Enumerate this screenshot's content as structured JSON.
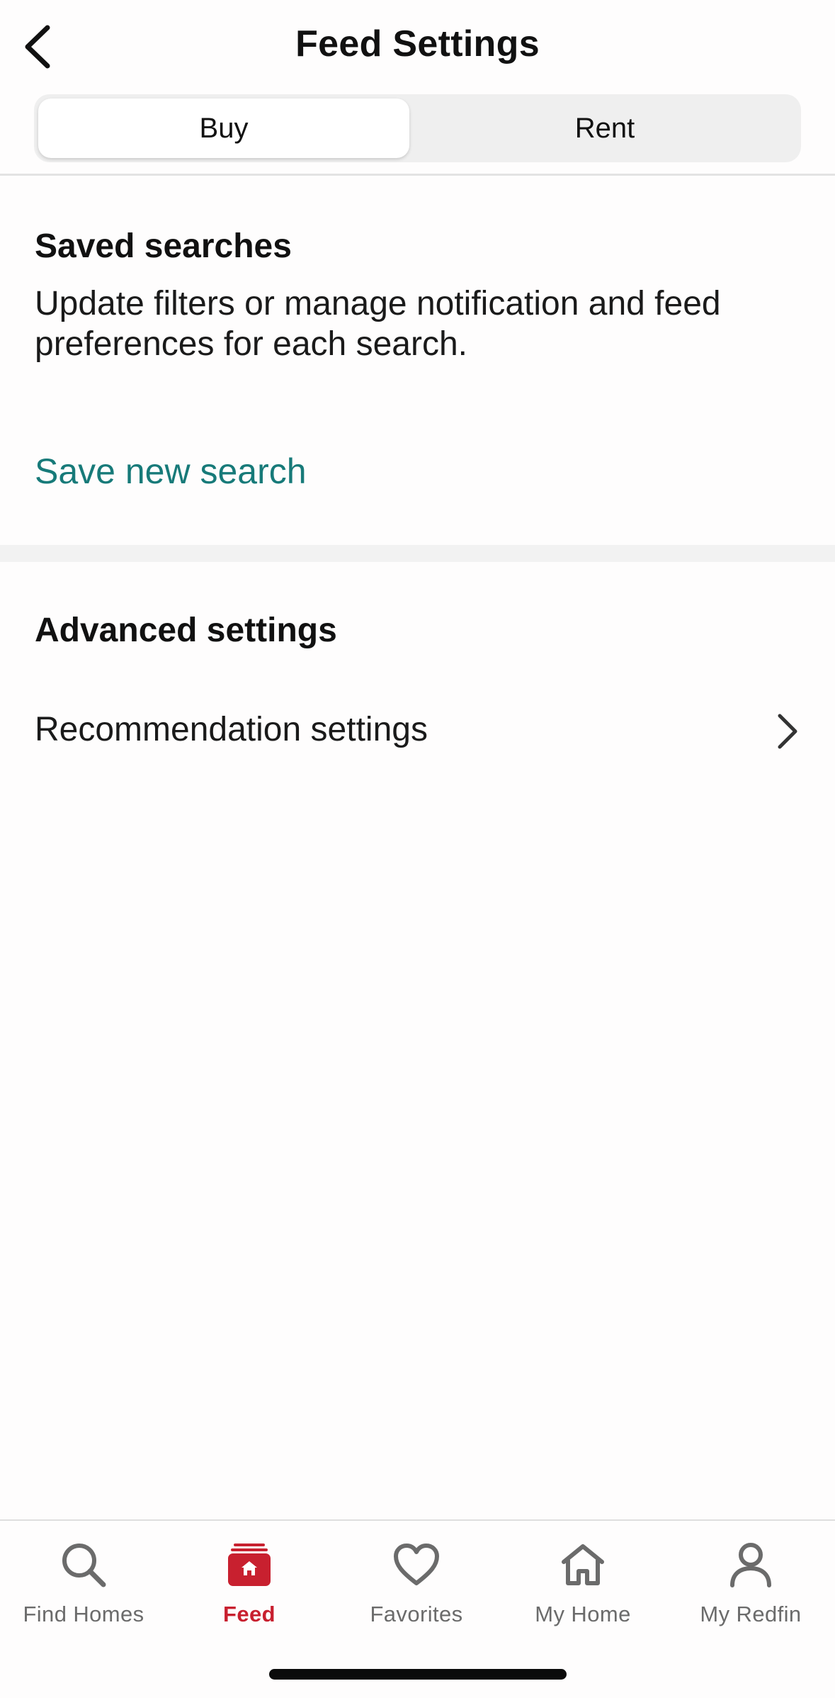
{
  "header": {
    "title": "Feed Settings",
    "segments": [
      {
        "label": "Buy",
        "selected": true
      },
      {
        "label": "Rent",
        "selected": false
      }
    ]
  },
  "saved_searches": {
    "title": "Saved searches",
    "description": "Update filters or manage notification and feed preferences for each search.",
    "save_link": "Save new search"
  },
  "advanced_settings": {
    "title": "Advanced settings",
    "items": [
      {
        "label": "Recommendation settings",
        "icon": "chevron-right-icon"
      }
    ]
  },
  "tabbar": {
    "active_color": "#c8202f",
    "items": [
      {
        "label": "Find Homes",
        "icon": "search-icon",
        "active": false
      },
      {
        "label": "Feed",
        "icon": "feed-icon",
        "active": true
      },
      {
        "label": "Favorites",
        "icon": "heart-icon",
        "active": false
      },
      {
        "label": "My Home",
        "icon": "house-icon",
        "active": false
      },
      {
        "label": "My Redfin",
        "icon": "person-icon",
        "active": false
      }
    ]
  },
  "colors": {
    "link": "#177a79",
    "accent": "#c8202f"
  }
}
